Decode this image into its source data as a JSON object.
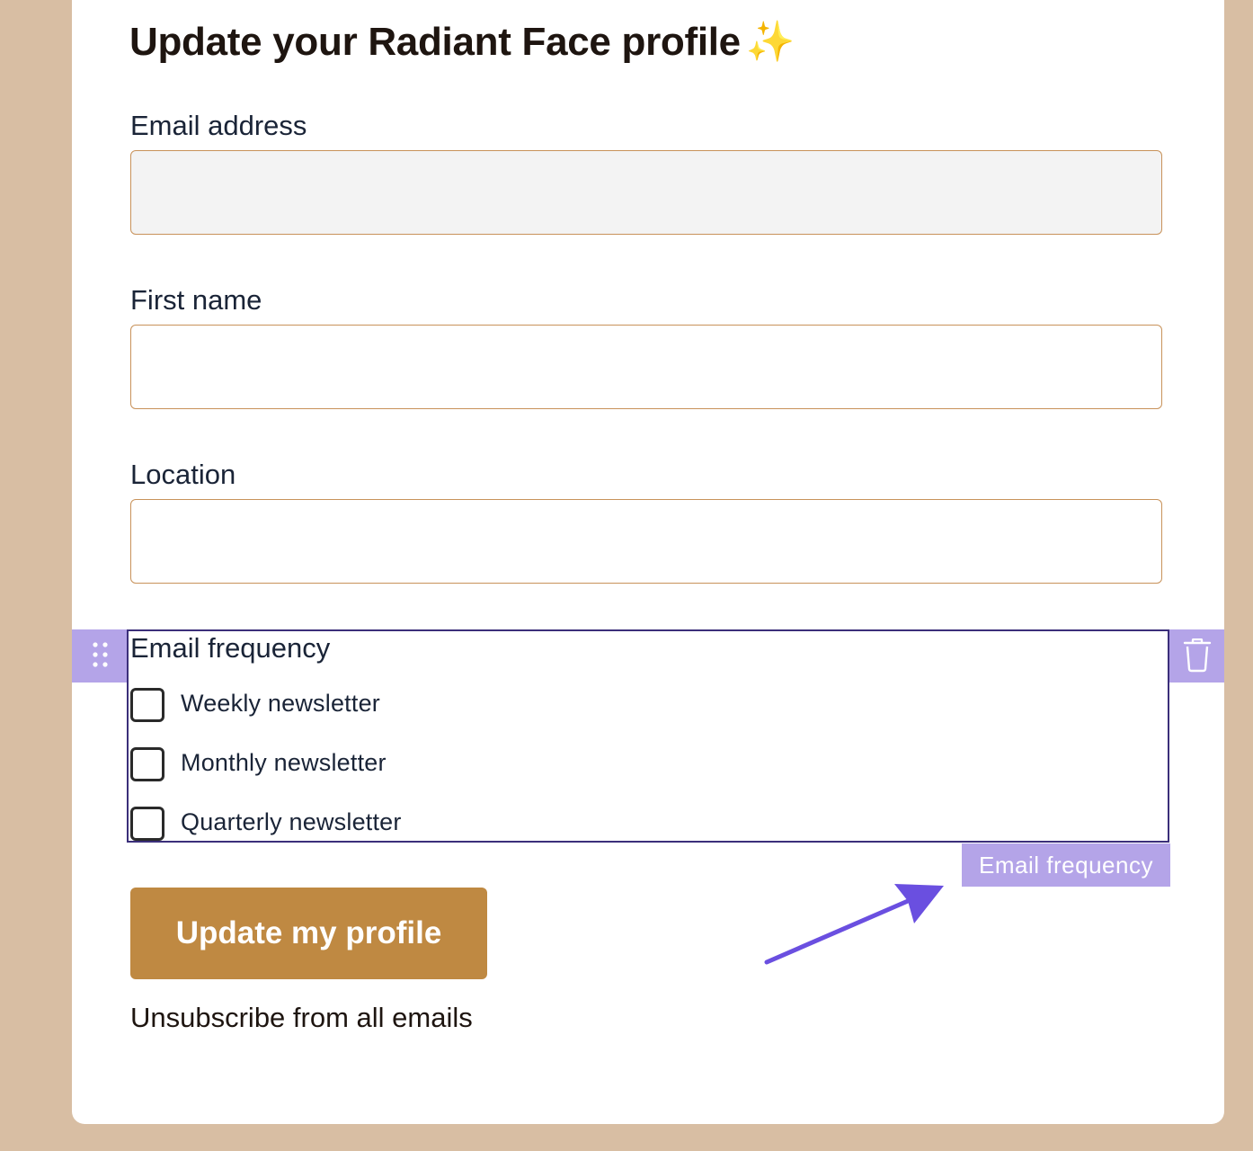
{
  "page": {
    "title": "Update your Radiant Face profile",
    "title_emoji": "✨"
  },
  "fields": {
    "email": {
      "label": "Email address",
      "value": ""
    },
    "first_name": {
      "label": "First name",
      "value": ""
    },
    "location": {
      "label": "Location",
      "value": ""
    }
  },
  "email_frequency": {
    "label": "Email frequency",
    "options": [
      {
        "label": "Weekly newsletter",
        "checked": false
      },
      {
        "label": "Monthly newsletter",
        "checked": false
      },
      {
        "label": "Quarterly newsletter",
        "checked": false
      }
    ],
    "block_tag": "Email frequency"
  },
  "actions": {
    "submit_label": "Update my profile",
    "unsubscribe_label": "Unsubscribe from all emails"
  },
  "colors": {
    "background": "#d8bea3",
    "brand": "#bf8942",
    "input_border": "#c8925a",
    "editor_accent": "#b4a4e8",
    "editor_frame": "#3b2f7a",
    "arrow": "#6a4fe0"
  },
  "icons": {
    "drag": "drag-handle-icon",
    "delete": "trash-icon",
    "pointer": "arrow-icon"
  }
}
